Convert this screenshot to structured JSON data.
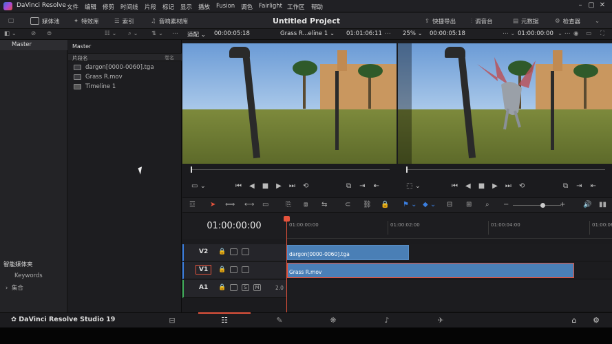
{
  "menubar": {
    "app_title": "DaVinci Resolve",
    "items": [
      "文件",
      "编辑",
      "修剪",
      "时间线",
      "片段",
      "标记",
      "显示",
      "播放",
      "Fusion",
      "调色",
      "Fairlight",
      "工作区",
      "帮助"
    ]
  },
  "toolbar": {
    "media_pool": "媒体池",
    "effects": "特效库",
    "index": "索引",
    "sound_library": "音响素材库",
    "project_title": "Untitled Project",
    "quick_export": "快捷导出",
    "mixer": "调音台",
    "metadata": "元数据",
    "inspector": "检查器"
  },
  "row2": {
    "fit": "适配",
    "source_tc": "00:00:05:18",
    "timeline_name": "Grass R...eline 1",
    "timeline_tc": "01:01:06:11",
    "zoom": "25%",
    "rec_tc": "00:00:05:18",
    "rec_tc2": "01:00:00:00"
  },
  "left": {
    "master": "Master",
    "smart_bins": "智能媒体夹",
    "keywords": "Keywords",
    "collections": "集合"
  },
  "media": {
    "master": "Master",
    "col_name": "片段名",
    "col_other": "卷名",
    "items": [
      "dargon[0000-0060].tga",
      "Grass R.mov",
      "Timeline 1"
    ]
  },
  "timeline": {
    "timecode": "01:00:00:00",
    "ruler": [
      "01:00:00:00",
      "01:00:02:00",
      "01:00:04:00",
      "01:00:06:0"
    ],
    "tracks": [
      {
        "label": "V2",
        "clip": "dargon[0000-0060].tga"
      },
      {
        "label": "V1",
        "clip": "Grass R.mov"
      },
      {
        "label": "A1",
        "level": "2.0"
      }
    ]
  },
  "bottom": {
    "brand": "DaVinci Resolve Studio 19"
  },
  "colors": {
    "accent": "#e5533c",
    "clip": "#4a7fb6"
  }
}
